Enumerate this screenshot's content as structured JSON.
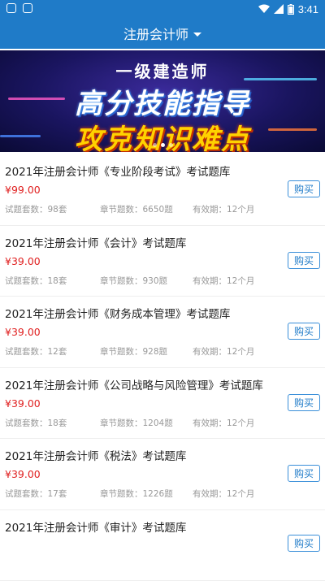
{
  "status_bar": {
    "time": "3:41"
  },
  "header": {
    "title": "注册会计师"
  },
  "banner": {
    "line1": "一级建造师",
    "line2": "高分技能指导",
    "line3": "攻克知识难点"
  },
  "labels": {
    "sets": "试题套数：",
    "chapters": "章节题数：",
    "valid": "有效期：",
    "buy": "购买"
  },
  "items": [
    {
      "title": "2021年注册会计师《专业阶段考试》考试题库",
      "price": "¥99.00",
      "sets": "98套",
      "chapters": "6650题",
      "valid": "12个月"
    },
    {
      "title": "2021年注册会计师《会计》考试题库",
      "price": "¥39.00",
      "sets": "18套",
      "chapters": "930题",
      "valid": "12个月"
    },
    {
      "title": "2021年注册会计师《财务成本管理》考试题库",
      "price": "¥39.00",
      "sets": "12套",
      "chapters": "928题",
      "valid": "12个月"
    },
    {
      "title": "2021年注册会计师《公司战略与风险管理》考试题库",
      "price": "¥39.00",
      "sets": "18套",
      "chapters": "1204题",
      "valid": "12个月"
    },
    {
      "title": "2021年注册会计师《税法》考试题库",
      "price": "¥39.00",
      "sets": "17套",
      "chapters": "1226题",
      "valid": "12个月"
    },
    {
      "title": "2021年注册会计师《审计》考试题库",
      "price": "",
      "sets": "",
      "chapters": "",
      "valid": ""
    }
  ],
  "colors": {
    "primary": "#1f7bc8",
    "price": "#e02020",
    "banner_yellow": "#ffd200"
  }
}
